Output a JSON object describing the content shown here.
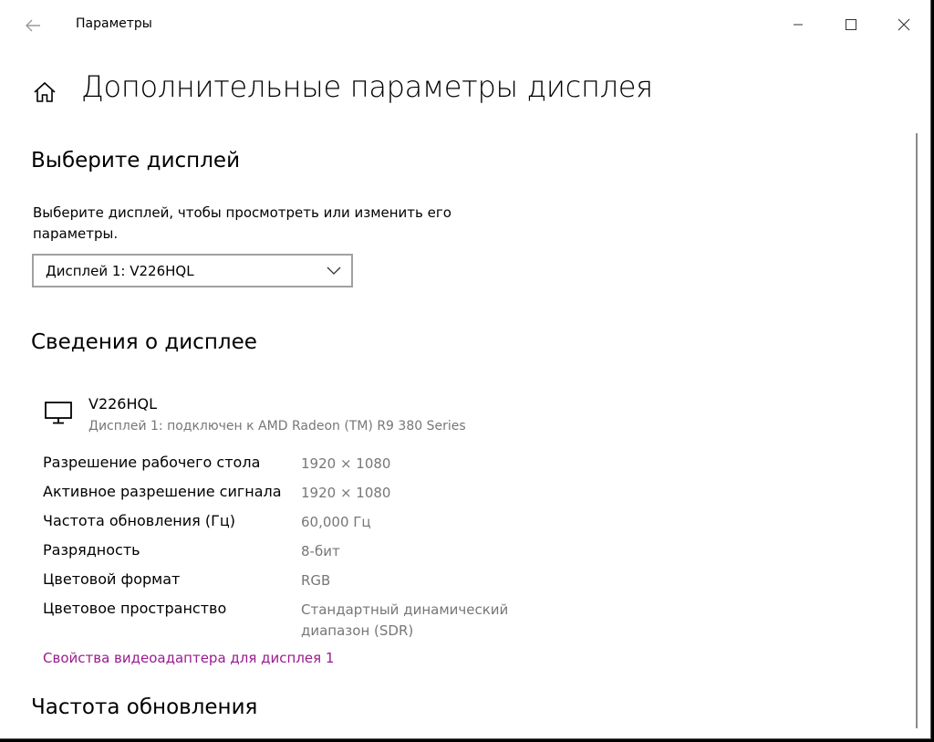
{
  "window": {
    "app_title": "Параметры"
  },
  "page": {
    "title": "Дополнительные параметры дисплея"
  },
  "select_display": {
    "heading": "Выберите дисплей",
    "description": "Выберите дисплей, чтобы просмотреть или изменить его параметры.",
    "dropdown_value": "Дисплей 1: V226HQL"
  },
  "display_info": {
    "heading": "Сведения о дисплее",
    "monitor_name": "V226HQL",
    "monitor_subtitle": "Дисплей 1: подключен к AMD Radeon (TM) R9 380 Series",
    "rows": [
      {
        "label": "Разрешение рабочего стола",
        "value": "1920 × 1080"
      },
      {
        "label": "Активное разрешение сигнала",
        "value": "1920 × 1080"
      },
      {
        "label": "Частота обновления (Гц)",
        "value": "60,000 Гц"
      },
      {
        "label": "Разрядность",
        "value": "8-бит"
      },
      {
        "label": "Цветовой формат",
        "value": "RGB"
      },
      {
        "label": "Цветовое пространство",
        "value": "Стандартный динамический диапазон (SDR)"
      }
    ],
    "adapter_link": "Свойства видеоадаптера для дисплея 1"
  },
  "refresh_rate": {
    "heading": "Частота обновления"
  },
  "colors": {
    "link": "#9b1b8f",
    "secondary_text": "#777777"
  },
  "icons": {
    "back": "back-arrow-icon",
    "home": "home-icon",
    "monitor": "monitor-icon",
    "chevron": "chevron-down-icon",
    "minimize": "minimize-icon",
    "maximize": "maximize-icon",
    "close": "close-icon"
  }
}
